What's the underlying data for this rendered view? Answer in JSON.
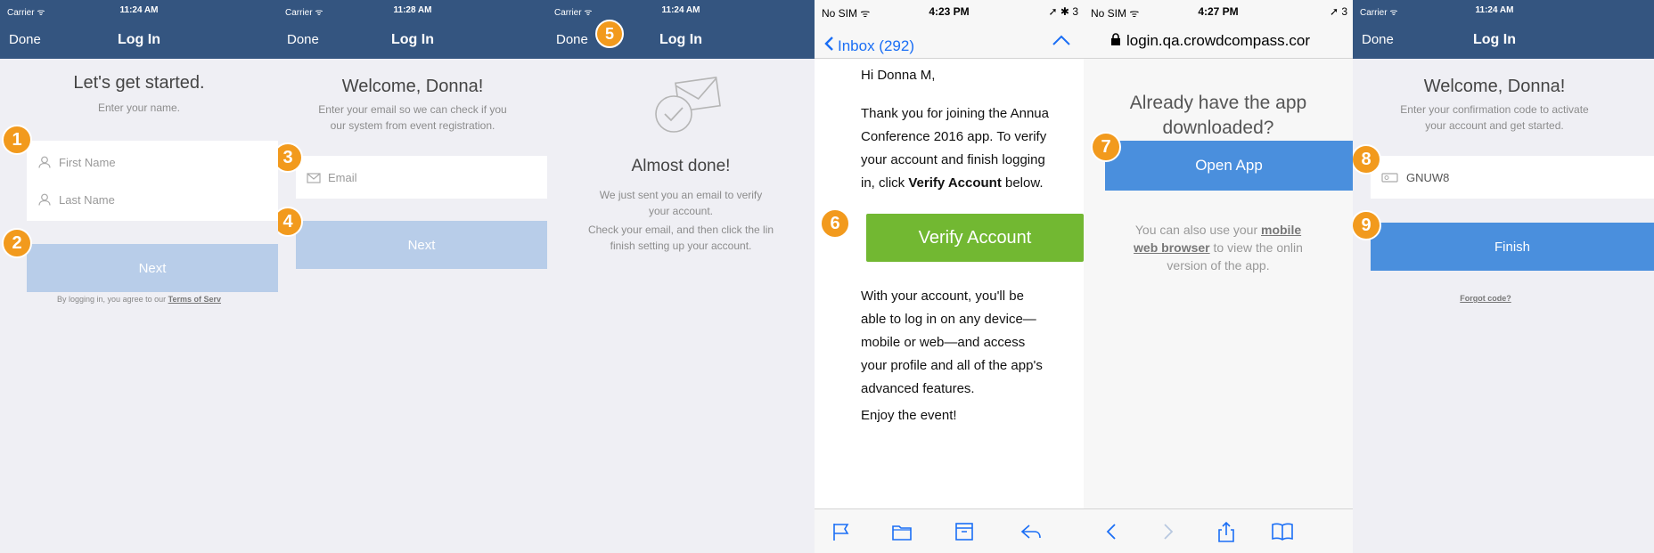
{
  "colors": {
    "navy": "#345580",
    "orange": "#f29a1d",
    "blue": "#4a8fdd",
    "green": "#72b832",
    "disabled": "#b8cde9"
  },
  "screen1": {
    "carrier": "Carrier ᯤ",
    "time": "11:24 AM",
    "done": "Done",
    "title": "Log In",
    "heading": "Let's get started.",
    "subtitle": "Enter your name.",
    "first_name_placeholder": "First Name",
    "last_name_placeholder": "Last Name",
    "next": "Next",
    "legal_prefix": "By logging in, you agree to our ",
    "legal_link": "Terms of Serv",
    "badge1": "1",
    "badge2": "2"
  },
  "screen2": {
    "carrier": "Carrier ᯤ",
    "time": "11:28 AM",
    "done": "Done",
    "title": "Log In",
    "heading": "Welcome, Donna!",
    "subtitle_line1": "Enter your email so we can check if you",
    "subtitle_line2": "our system from event registration.",
    "email_placeholder": "Email",
    "next": "Next",
    "badge3": "3",
    "badge4": "4"
  },
  "screen3": {
    "carrier": "Carrier ᯤ",
    "time": "11:24 AM",
    "done": "Done",
    "title": "Log In",
    "badge5": "5",
    "heading": "Almost done!",
    "line1": "We just sent you an email to verify",
    "line2": "your account.",
    "line3": "Check your email, and then click the lin",
    "line4": "finish setting up your account."
  },
  "screen4": {
    "status_left": "No SIM ᯤ",
    "time": "4:23 PM",
    "status_right": "➚ ✱ 3",
    "inbox": "Inbox (292)",
    "greeting": "Hi Donna M,",
    "para1_a": "Thank you for joining the Annua",
    "para1_b": "Conference 2016 app. To verify",
    "para1_c": "your account and finish logging",
    "para1_d_prefix": "in, click ",
    "para1_d_bold": "Verify Account",
    "para1_d_suffix": " below.",
    "badge6": "6",
    "verify_button": "Verify Account",
    "para2_a": "With your account, you'll be",
    "para2_b": "able to log in on any device—",
    "para2_c": "mobile or web—and access",
    "para2_d": "your profile and all of the app's",
    "para2_e": "advanced features.",
    "closing": "Enjoy the event!"
  },
  "screen5": {
    "status_left": "No SIM ᯤ",
    "time": "4:27 PM",
    "status_right": "➚ 3",
    "url": "login.qa.crowdcompass.cor",
    "heading_line1": "Already have the app",
    "heading_line2": "downloaded?",
    "badge7": "7",
    "open_app": "Open App",
    "text_prefix": "You can also use your ",
    "text_link1": "mobile",
    "text_link2": "web browser",
    "text_mid": " to view the onlin",
    "text_line3": "version of the app."
  },
  "screen6": {
    "carrier": "Carrier ᯤ",
    "time": "11:24 AM",
    "done": "Done",
    "title": "Log In",
    "heading": "Welcome, Donna!",
    "subtitle_line1": "Enter your confirmation code to activate",
    "subtitle_line2": "your account and get started.",
    "badge8": "8",
    "code_value": "GNUW8",
    "badge9": "9",
    "finish": "Finish",
    "forgot": "Forgot code?"
  }
}
